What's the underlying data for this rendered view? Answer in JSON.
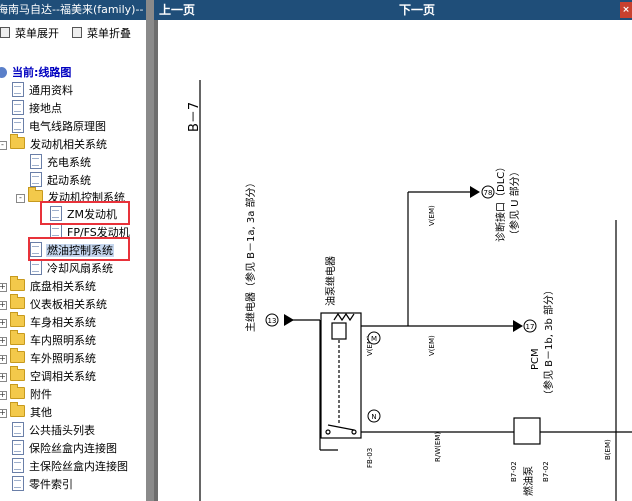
{
  "left": {
    "title": "海南马自达--福美来(family)--",
    "expand_label": "菜单展开",
    "collapse_label": "菜单折叠",
    "tree": [
      {
        "label": "当前:线路图",
        "type": "root"
      },
      {
        "label": "通用资料",
        "type": "doc"
      },
      {
        "label": "接地点",
        "type": "doc"
      },
      {
        "label": "电气线路原理图",
        "type": "doc"
      },
      {
        "label": "发动机相关系统",
        "type": "folder-open"
      },
      {
        "label": "充电系统",
        "type": "doc"
      },
      {
        "label": "起动系统",
        "type": "doc"
      },
      {
        "label": "发动机控制系统",
        "type": "folder-open"
      },
      {
        "label": "ZM发动机",
        "type": "doc"
      },
      {
        "label": "FP/FS发动机",
        "type": "doc"
      },
      {
        "label": "燃油控制系统",
        "type": "doc"
      },
      {
        "label": "冷却风扇系统",
        "type": "doc"
      },
      {
        "label": "底盘相关系统",
        "type": "folder"
      },
      {
        "label": "仪表板相关系统",
        "type": "folder"
      },
      {
        "label": "车身相关系统",
        "type": "folder"
      },
      {
        "label": "车内照明系统",
        "type": "folder"
      },
      {
        "label": "车外照明系统",
        "type": "folder"
      },
      {
        "label": "空调相关系统",
        "type": "folder"
      },
      {
        "label": "附件",
        "type": "folder"
      },
      {
        "label": "其他",
        "type": "folder"
      },
      {
        "label": "公共插头列表",
        "type": "doc"
      },
      {
        "label": "保险丝盒内连接图",
        "type": "doc"
      },
      {
        "label": "主保险丝盒内连接图",
        "type": "doc"
      },
      {
        "label": "零件索引",
        "type": "doc"
      }
    ]
  },
  "nav": {
    "prev_label": "上一页",
    "next_label": "下一页",
    "close_label": "×"
  },
  "schematic": {
    "page_code": "B－7",
    "main_relay": "主继电器（参见 B－1a, 3a 部分）",
    "fuel_pump_relay": "油泵继电器",
    "dlc": "诊断接口（DLC）",
    "dlc_ref": "（参见 U 部分）",
    "pcm": "PCM",
    "pcm_ref": "（参见 B－1b, 3b 部分）",
    "fuel_pump": "燃油泵",
    "wire_v": "V(EM)",
    "wire_rw": "R/W(EM)",
    "wire_b": "B(EM)",
    "conn_13": "13",
    "conn_78": "78",
    "conn_17": "17",
    "conn_m": "M",
    "conn_n": "N",
    "conn_fb03": "FB-03",
    "conn_b702a": "B7-02",
    "conn_b702b": "B7-02"
  }
}
